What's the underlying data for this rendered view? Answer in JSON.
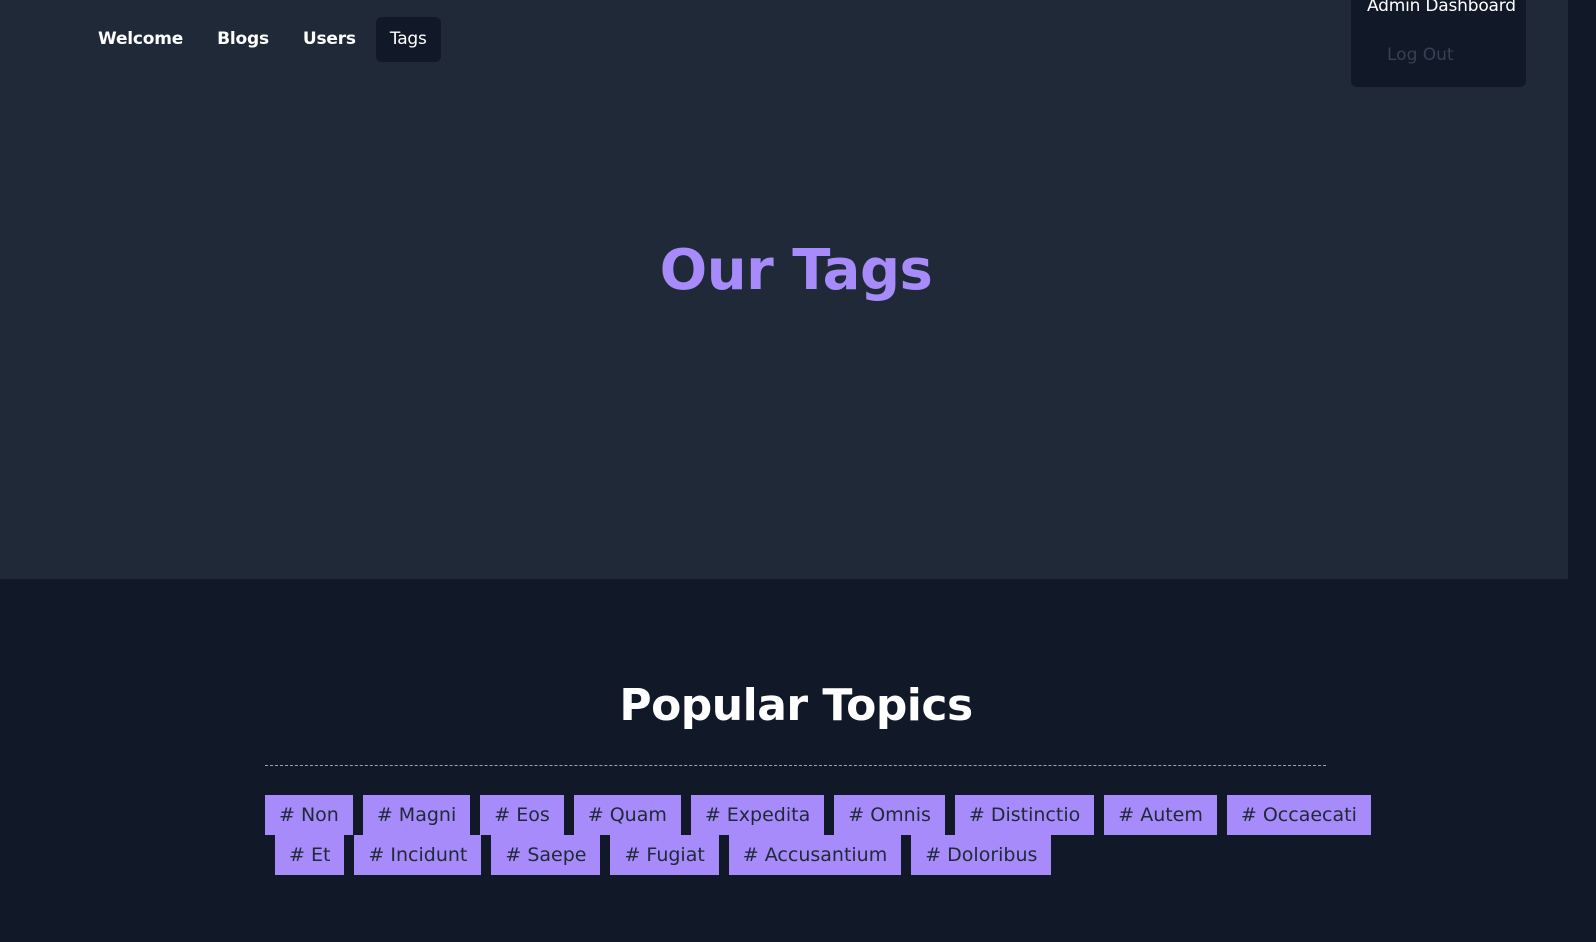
{
  "nav": {
    "items": [
      {
        "label": "Welcome"
      },
      {
        "label": "Blogs"
      },
      {
        "label": "Users"
      },
      {
        "label": "Tags"
      }
    ]
  },
  "dropdown": {
    "title": "Admin Dashboard",
    "logout": "Log Out"
  },
  "hero": {
    "title": "Our Tags"
  },
  "popular": {
    "title": "Popular Topics",
    "tags_row1": [
      "# Non",
      "# Magni",
      "# Eos",
      "# Quam",
      "# Expedita",
      "# Omnis",
      "# Distinctio",
      "# Autem",
      "# Occaecati"
    ],
    "tags_row2": [
      "# Et",
      "# Incidunt",
      "# Saepe",
      "# Fugiat",
      "# Accusantium",
      "# Doloribus"
    ]
  },
  "colors": {
    "accent": "#a78bfa",
    "hero_bg": "#1f2937",
    "page_bg": "#111827"
  }
}
